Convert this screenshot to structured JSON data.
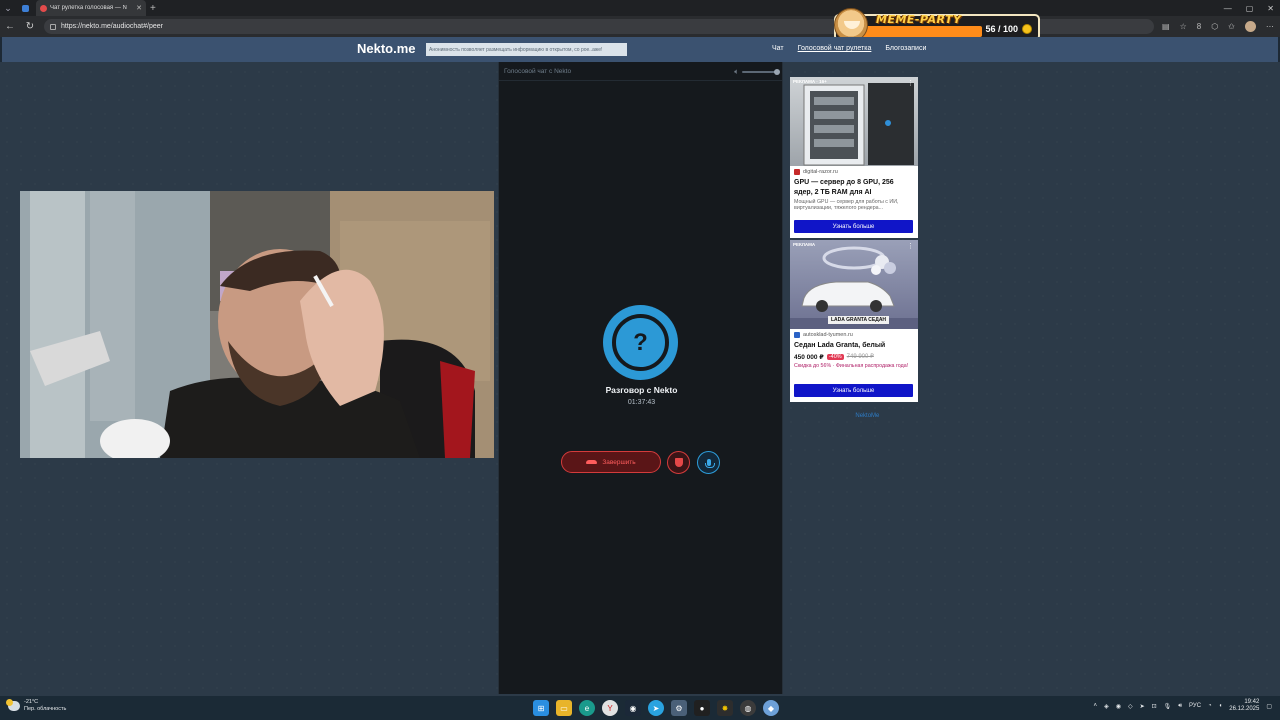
{
  "browser": {
    "tabs": [
      {
        "title": "",
        "active": false
      },
      {
        "title": "Чат рулетка голосовая — N",
        "active": true
      }
    ],
    "url": "https://nekto.me/audiochat#/peer",
    "extension_badge": "8"
  },
  "overlay": {
    "title": "MEME-PARTY",
    "count": "56 / 100"
  },
  "site": {
    "logo": "Nekto.me",
    "notice": "Анонимность позволяет размещать информацию в открытом, со рое..аже!",
    "menu": [
      {
        "label": "Чат"
      },
      {
        "label": "Голосовой чат рулетка",
        "active": true
      },
      {
        "label": "Блогозаписи"
      }
    ]
  },
  "voice_chat": {
    "header": "Голосовой чат с Nekto",
    "avatar_symbol": "?",
    "conversation_title": "Разговор с Nekto",
    "timer": "01:37:43",
    "end_button": "Завершить"
  },
  "ads": [
    {
      "tag": "РЕКЛАМА · 16+",
      "source": "digital-razor.ru",
      "title": "GPU — сервер до 8 GPU, 256 ядер, 2 ТБ RAM для AI",
      "desc": "Мощный GPU — сервер для работы с ИИ, виртуализации, тяжелого рендера...",
      "button": "Узнать больше"
    },
    {
      "tag": "РЕКЛАМА",
      "image_caption": "LADA GRANTA СЕДАН",
      "source": "autosklad-tyumen.ru",
      "title": "Седан Lada Granta, белый",
      "price_new": "450 000 ₽",
      "discount": "-40%",
      "price_old": "749 900 ₽",
      "promo": "Скидка до 56% · Финальная распродажа года!",
      "button": "Узнать больше"
    }
  ],
  "footer": {
    "copyright": "© 2011–2025",
    "link": "NektoMe"
  },
  "taskbar": {
    "temperature": "-21°C",
    "weather": "Пер. облачность",
    "lang": "РУС",
    "time": "19:42",
    "date": "26.12.2025"
  },
  "colors": {
    "page_bg": "#2c3a48",
    "header_bg": "#3b5270",
    "panel_bg": "#15191d",
    "accent_blue": "#2c99d6",
    "danger_red": "#d43b3b",
    "ad_button": "#1015c8"
  }
}
